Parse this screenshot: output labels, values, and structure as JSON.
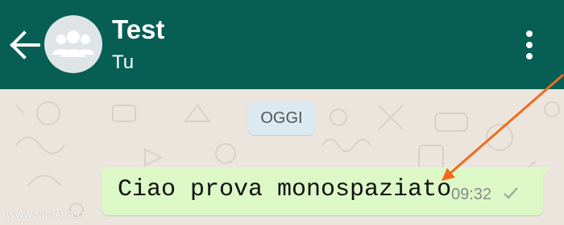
{
  "header": {
    "title": "Test",
    "subtitle": "Tu",
    "back_icon": "arrow-left-icon",
    "avatar_icon": "group-icon",
    "menu_icon": "more-vert-icon"
  },
  "chat": {
    "date_label": "OGGI",
    "message": {
      "text": "Ciao prova monospaziato",
      "time": "09:32",
      "status_icon": "single-check-icon"
    }
  },
  "watermark": "WWW.NIGIARA.IT",
  "colors": {
    "header_bg": "#075e54",
    "chat_bg": "#ece5dd",
    "bubble_bg": "#dcf8c6",
    "date_chip_bg": "#dbe9f0",
    "annotation_arrow": "#f26a1b"
  }
}
